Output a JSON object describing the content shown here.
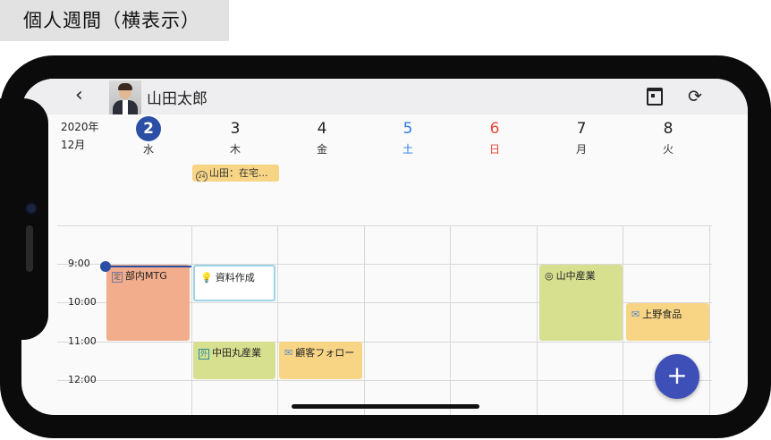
{
  "caption": "個人週間（横表示）",
  "header": {
    "user_name": "山田太郎",
    "back_icon": "chevron-left-icon",
    "calendar_icon": "calendar-icon",
    "refresh_icon": "refresh-icon"
  },
  "period": {
    "year": "2020年",
    "month": "12月"
  },
  "days": [
    {
      "num": "2",
      "weekday": "水",
      "today": true
    },
    {
      "num": "3",
      "weekday": "木"
    },
    {
      "num": "4",
      "weekday": "金"
    },
    {
      "num": "5",
      "weekday": "土"
    },
    {
      "num": "6",
      "weekday": "日"
    },
    {
      "num": "7",
      "weekday": "月"
    },
    {
      "num": "8",
      "weekday": "火"
    }
  ],
  "allday_event": {
    "label": "山田：在宅...",
    "badge": "24"
  },
  "times": [
    "9:00",
    "10:00",
    "11:00",
    "12:00"
  ],
  "events": [
    {
      "title": "部内MTG",
      "tag": "定",
      "color": "#f2ad8c"
    },
    {
      "title": "資料作成",
      "icon": "lightbulb-icon",
      "color": "#ffffff"
    },
    {
      "title": "山中産業",
      "icon": "target-icon",
      "color": "#d6e08f"
    },
    {
      "title": "上野食品",
      "icon": "mail-icon",
      "color": "#f7d585"
    },
    {
      "title": "中田丸産業",
      "tag": "外",
      "color": "#d6e08f"
    },
    {
      "title": "顧客フォロー",
      "icon": "mail-icon",
      "color": "#f7d585"
    }
  ],
  "fab_label": "+",
  "colors": {
    "accent": "#2a4fa5",
    "fab": "#3f4fb8",
    "saturday": "#2e7ae6",
    "sunday": "#e04a3a"
  }
}
